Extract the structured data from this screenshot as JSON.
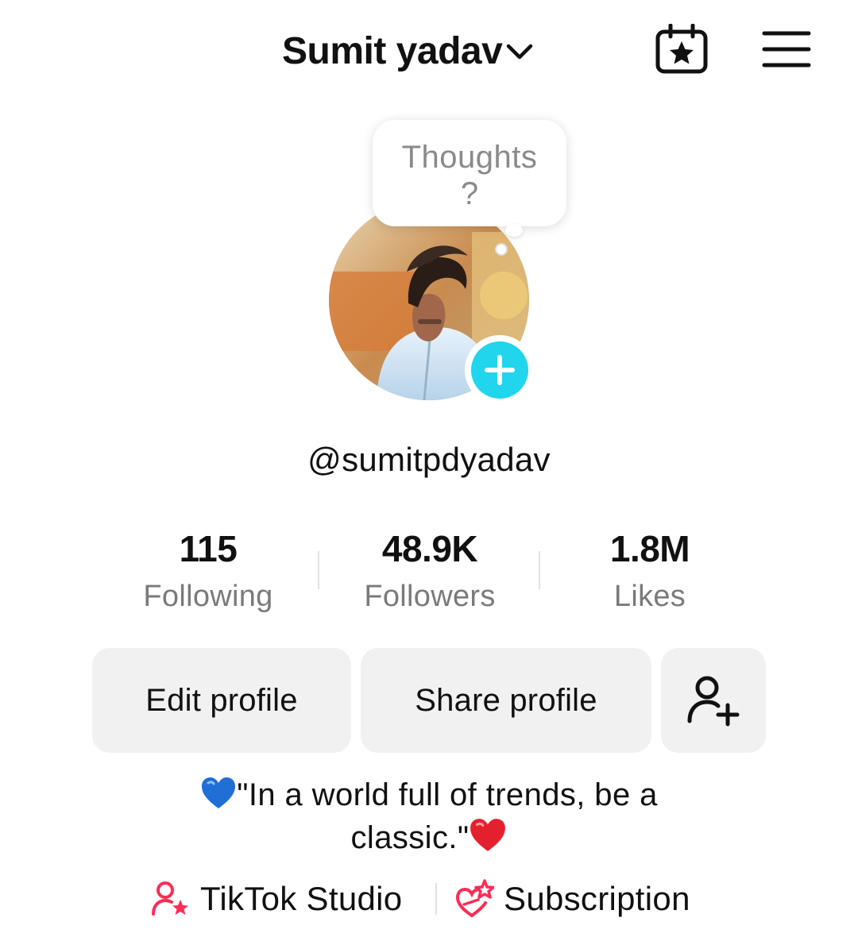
{
  "header": {
    "account_name": "Sumit yadav",
    "chevron_icon": "chevron-down-icon",
    "calendar_icon": "calendar-star-icon",
    "menu_icon": "hamburger-menu-icon"
  },
  "thought_bubble": {
    "text": "Thoughts",
    "mark": "?"
  },
  "profile": {
    "avatar_icon": "profile-photo",
    "add_icon": "plus-icon",
    "add_color": "#20d5ec",
    "username": "@sumitpdyadav"
  },
  "stats": [
    {
      "value": "115",
      "label": "Following"
    },
    {
      "value": "48.9K",
      "label": "Followers"
    },
    {
      "value": "1.8M",
      "label": "Likes"
    }
  ],
  "actions": {
    "edit_label": "Edit profile",
    "share_label": "Share profile",
    "add_friend_icon": "add-friend-icon"
  },
  "bio": {
    "line1": "\"In a world full of trends, be a",
    "line2": "classic.\"",
    "leading_emoji": "blue-heart-icon",
    "trailing_emoji": "red-heart-icon"
  },
  "links": {
    "studio_label": "TikTok Studio",
    "studio_icon": "person-star-icon",
    "subscription_label": "Subscription",
    "subscription_icon": "heart-star-icon",
    "accent": "#fe2c55"
  }
}
